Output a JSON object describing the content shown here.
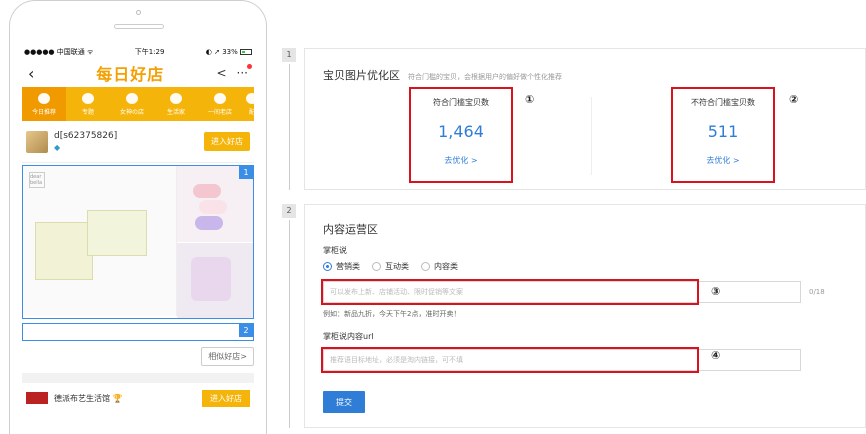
{
  "phone": {
    "status": {
      "carrier": "●●●●● 中国联通 ᯤ",
      "time": "下午1:29",
      "right": "◐ ➚ 33%"
    },
    "header": {
      "back": "‹",
      "logo": "每日好店",
      "share": "<",
      "more": "···"
    },
    "nav": [
      "今日推荐",
      "专题",
      "女神の店",
      "生活家",
      "一间老店",
      "配"
    ],
    "store": {
      "name": "d[s62375826]",
      "badge": "◆",
      "enter": "进入好店"
    },
    "product": {
      "logo_text": "dear bella",
      "index_main": "1",
      "index_empty": "2"
    },
    "similar": "相似好店>",
    "store2": {
      "name": "德派布艺生活馆 🏆",
      "enter": "进入好店"
    }
  },
  "steps": {
    "one": "1",
    "two": "2"
  },
  "card1": {
    "title": "宝贝图片优化区",
    "subtitle": "符合门槛的宝贝，会根据用户的偏好做个性化推荐",
    "stat1": {
      "label": "符合门槛宝贝数",
      "value": "1,464",
      "link": "去优化 >",
      "marker": "①"
    },
    "stat2": {
      "label": "不符合门槛宝贝数",
      "value": "511",
      "link": "去优化 >",
      "marker": "②"
    }
  },
  "card2": {
    "title": "内容运营区",
    "field1_label": "掌柜说",
    "radios": [
      {
        "label": "营销类",
        "checked": true
      },
      {
        "label": "互动类",
        "checked": false
      },
      {
        "label": "内容类",
        "checked": false
      }
    ],
    "input1_placeholder": "可以发布上新、店铺活动、限时促销等文案",
    "input1_counter": "0/18",
    "input1_marker": "③",
    "example": "例如：新品九折，今天下午2点，准时开卖！",
    "field2_label": "掌柜说内容url",
    "input2_placeholder": "推荐语目标地址，必须是淘内链接，可不填",
    "input2_marker": "④",
    "submit": "提交"
  }
}
